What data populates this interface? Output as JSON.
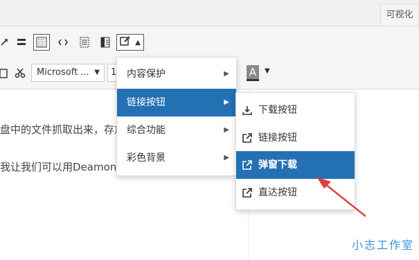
{
  "header": {
    "tab_visual": "可视化"
  },
  "toolbar": {
    "row1_icons": [
      "link-icon",
      "horizontal-line-icon",
      "toolbar-toggle-icon",
      "code-icon",
      "table-grid-icon",
      "layout-icon",
      "edit-dropdown-icon"
    ],
    "row2_icons": [
      "paste-icon",
      "scissors-icon"
    ],
    "font_family": "Microsoft ...",
    "font_size": "1",
    "text_color_letter": "A",
    "caret": "▲",
    "caret_down": "▼"
  },
  "content": {
    "line1": "盘中的文件抓取出来，存放",
    "line2": "我让我们可以用Deamon一"
  },
  "menu": {
    "items": [
      {
        "label": "内容保护",
        "arrow": "▶"
      },
      {
        "label": "链接按钮",
        "arrow": "▶"
      },
      {
        "label": "综合功能",
        "arrow": "▶"
      },
      {
        "label": "彩色背景",
        "arrow": "▶"
      }
    ]
  },
  "submenu": {
    "items": [
      {
        "label": "下载按钮",
        "icon": "download-icon"
      },
      {
        "label": "链接按钮",
        "icon": "external-link-icon"
      },
      {
        "label": "弹窗下载",
        "icon": "external-link-icon"
      },
      {
        "label": "直达按钮",
        "icon": "external-link-icon"
      }
    ]
  },
  "colors": {
    "menu_active": "#2370b3",
    "watermark": "#3b8fd9",
    "arrow": "#e0403a"
  },
  "watermark": "小志工作室"
}
